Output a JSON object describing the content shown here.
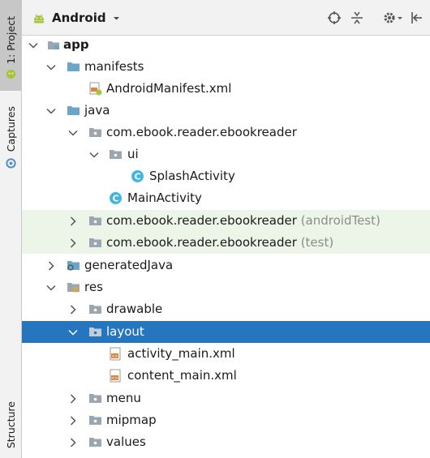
{
  "sidebar": {
    "tab_project": "1: Project",
    "tab_captures": "Captures",
    "tab_structure": "Structure"
  },
  "toolbar": {
    "view_selector": "Android",
    "icons": [
      "locate-icon",
      "collapse-all-icon",
      "settings-icon",
      "hide-panel-icon"
    ]
  },
  "tree": {
    "app": "app",
    "manifests": "manifests",
    "android_manifest": "AndroidManifest.xml",
    "java": "java",
    "pkg_main": "com.ebook.reader.ebookreader",
    "ui": "ui",
    "splash_activity": "SplashActivity",
    "main_activity": "MainActivity",
    "pkg_android_test": "com.ebook.reader.ebookreader",
    "pkg_android_test_suffix": "(androidTest)",
    "pkg_test": "com.ebook.reader.ebookreader",
    "pkg_test_suffix": "(test)",
    "generated_java": "generatedJava",
    "res": "res",
    "drawable": "drawable",
    "layout": "layout",
    "activity_main": "activity_main.xml",
    "content_main": "content_main.xml",
    "menu": "menu",
    "mipmap": "mipmap",
    "values": "values"
  },
  "colors": {
    "selection": "#2675bf",
    "test_highlight": "#edf5e8",
    "folder": "#6ba5c8",
    "package": "#9aa7b0",
    "class_icon": "#40b6e0",
    "android_green": "#a4c639"
  }
}
